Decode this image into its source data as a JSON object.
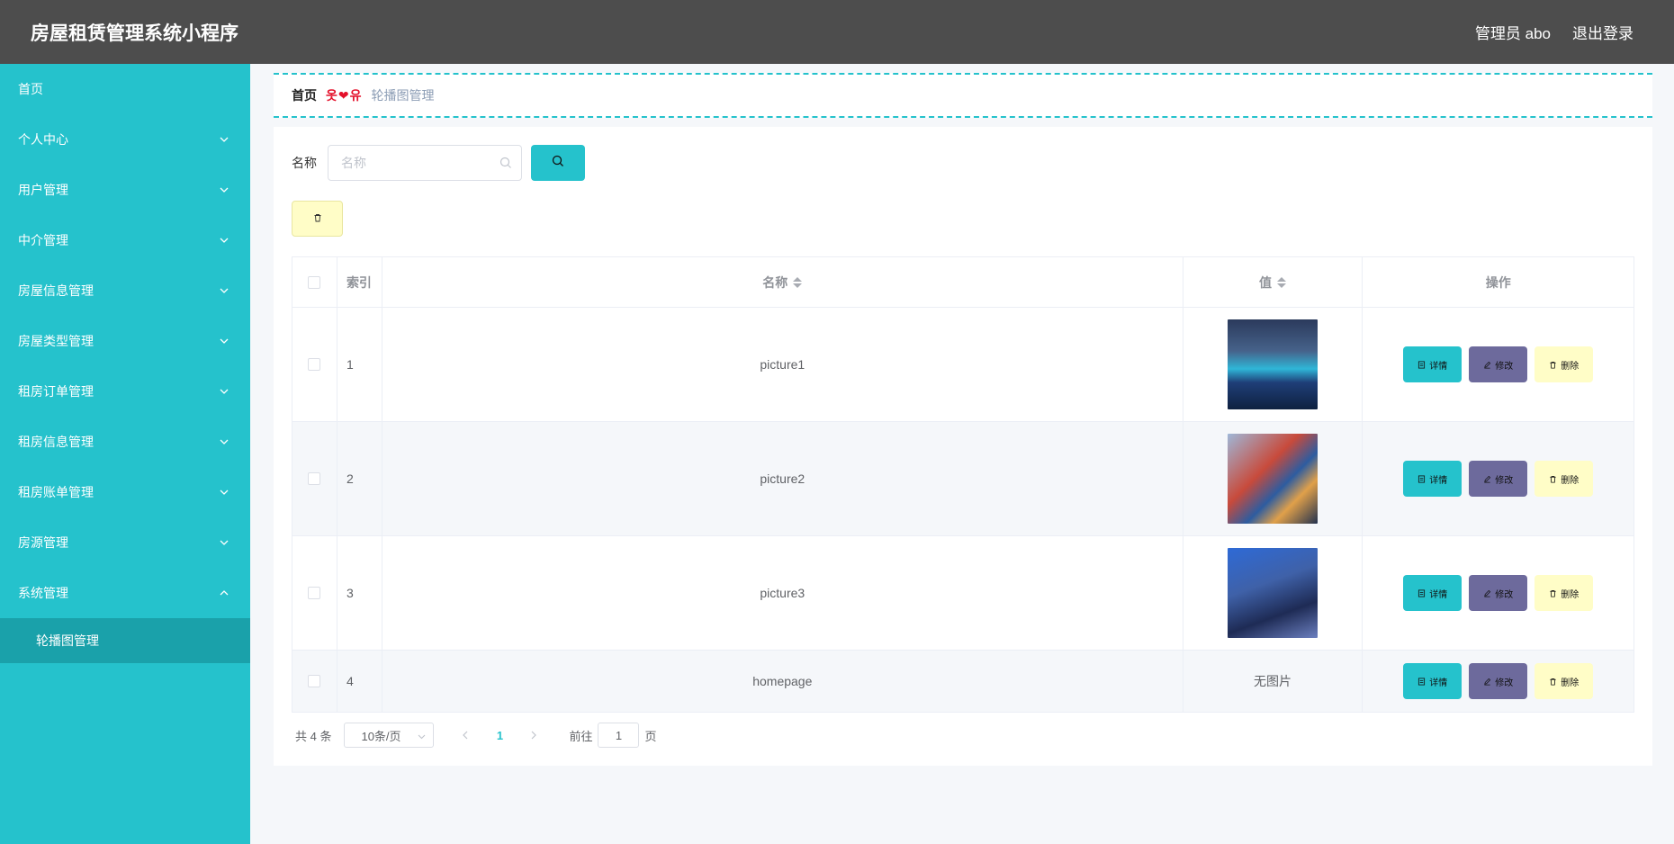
{
  "header": {
    "title": "房屋租赁管理系统小程序",
    "user": "管理员 abo",
    "logout": "退出登录"
  },
  "sidebar": {
    "items": [
      {
        "label": "首页",
        "has_arrow": false
      },
      {
        "label": "个人中心",
        "has_arrow": true,
        "arrow": "down"
      },
      {
        "label": "用户管理",
        "has_arrow": true,
        "arrow": "down"
      },
      {
        "label": "中介管理",
        "has_arrow": true,
        "arrow": "down"
      },
      {
        "label": "房屋信息管理",
        "has_arrow": true,
        "arrow": "down"
      },
      {
        "label": "房屋类型管理",
        "has_arrow": true,
        "arrow": "down"
      },
      {
        "label": "租房订单管理",
        "has_arrow": true,
        "arrow": "down"
      },
      {
        "label": "租房信息管理",
        "has_arrow": true,
        "arrow": "down"
      },
      {
        "label": "租房账单管理",
        "has_arrow": true,
        "arrow": "down"
      },
      {
        "label": "房源管理",
        "has_arrow": true,
        "arrow": "down"
      },
      {
        "label": "系统管理",
        "has_arrow": true,
        "arrow": "up",
        "expanded": true
      }
    ],
    "submenu": {
      "label": "轮播图管理",
      "active": true
    }
  },
  "breadcrumb": {
    "home": "首页",
    "separator": "옷❤유",
    "current": "轮播图管理"
  },
  "search": {
    "label": "名称",
    "placeholder": "名称",
    "value": ""
  },
  "table": {
    "headers": {
      "index": "索引",
      "name": "名称",
      "value": "值",
      "operation": "操作"
    },
    "rows": [
      {
        "index": "1",
        "name": "picture1",
        "has_image": true
      },
      {
        "index": "2",
        "name": "picture2",
        "has_image": true
      },
      {
        "index": "3",
        "name": "picture3",
        "has_image": true
      },
      {
        "index": "4",
        "name": "homepage",
        "has_image": false,
        "value_text": "无图片"
      }
    ],
    "actions": {
      "detail": "详情",
      "edit": "修改",
      "delete": "删除"
    }
  },
  "pagination": {
    "total": "共 4 条",
    "page_size": "10条/页",
    "current_page": "1",
    "goto_label": "前往",
    "goto_value": "1",
    "goto_suffix": "页"
  },
  "colors": {
    "accent": "#25c2cc",
    "header_bg": "#4d4d4d",
    "edit_btn": "#6d6a9c",
    "delete_btn": "#fffdc7"
  }
}
